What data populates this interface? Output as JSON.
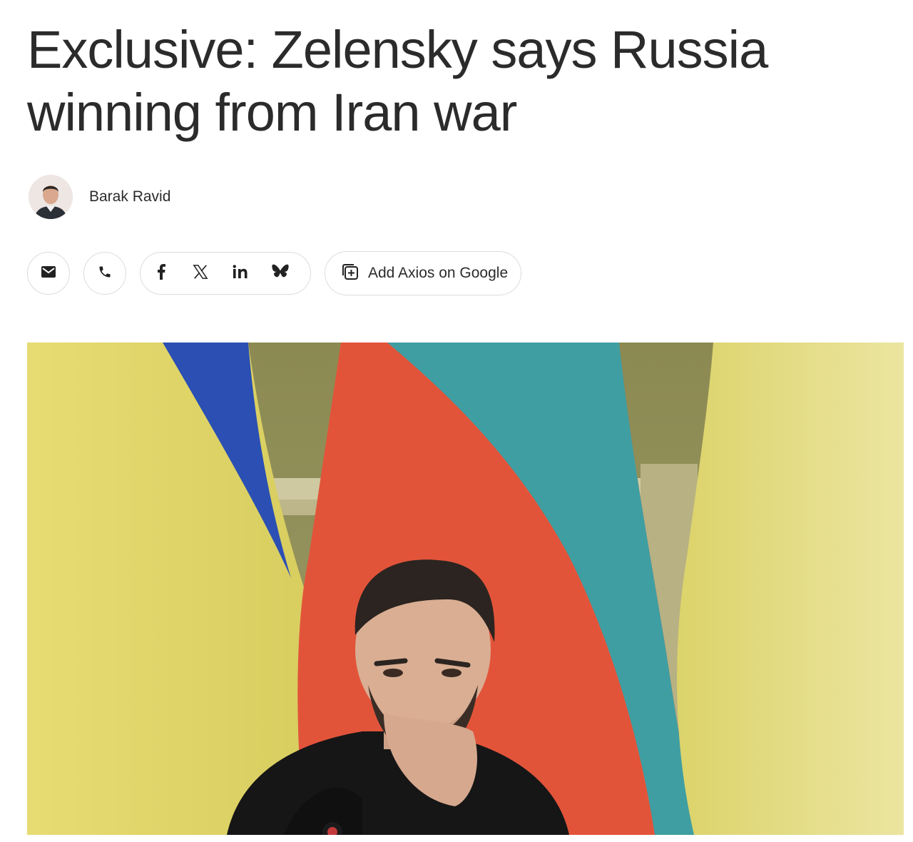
{
  "article": {
    "headline": "Exclusive: Zelensky says Russia winning from Iran war",
    "author": {
      "name": "Barak Ravid",
      "avatar_icon": "author-photo"
    }
  },
  "share": {
    "email_icon": "email-icon",
    "phone_icon": "phone-icon",
    "social": [
      {
        "name": "facebook",
        "icon": "facebook-icon"
      },
      {
        "name": "x",
        "icon": "x-icon"
      },
      {
        "name": "linkedin",
        "icon": "linkedin-icon"
      },
      {
        "name": "bluesky",
        "icon": "bluesky-icon"
      }
    ],
    "google_label": "Add Axios on Google",
    "google_icon": "add-source-icon"
  },
  "hero_image": {
    "subject": "man with hand on chin in front of Ukrainian and Bulgarian flags",
    "colors": {
      "ukraine_blue": "#2b4fb3",
      "ukraine_yellow": "#e3d86e",
      "bulgaria_red": "#e2543a",
      "bulgaria_green": "#3f9ea2",
      "wall": "#8a8a4f"
    }
  }
}
